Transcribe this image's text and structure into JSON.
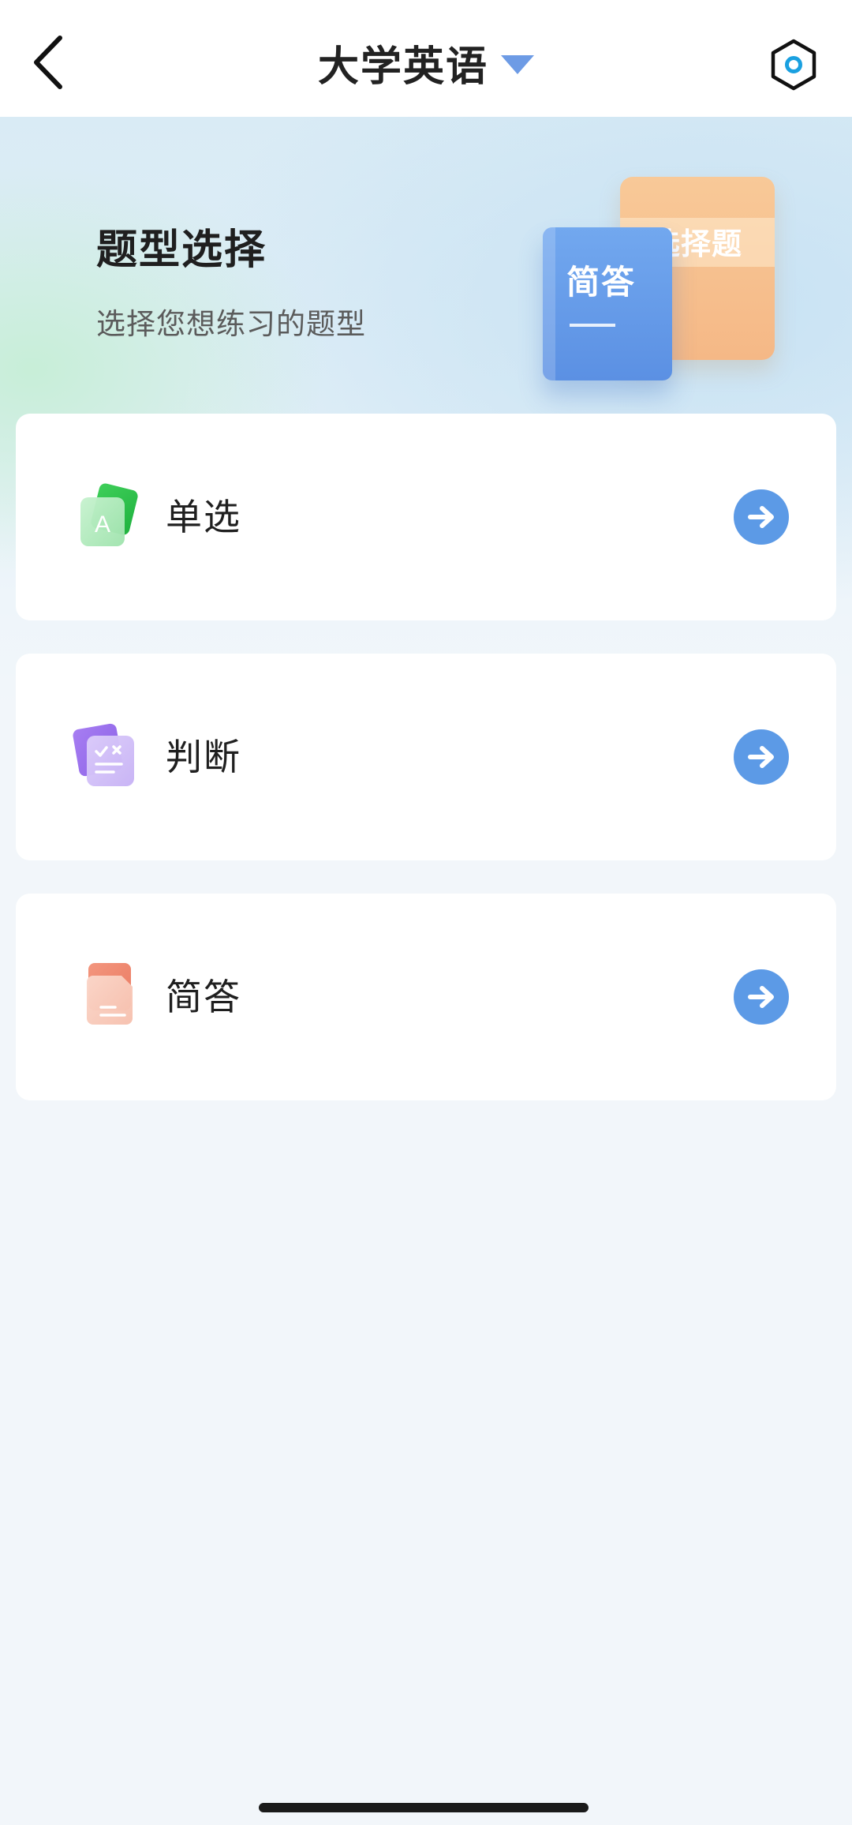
{
  "header": {
    "title": "大学英语",
    "back_icon": "chevron-left-icon",
    "dropdown_icon": "caret-down-icon",
    "settings_icon": "hexagon-settings-icon"
  },
  "banner": {
    "title": "题型选择",
    "subtitle": "选择您想练习的题型",
    "back_book_label": "选择题",
    "front_book_label": "简答"
  },
  "question_types": [
    {
      "label": "单选",
      "icon": "single-choice-icon",
      "arrow_icon": "arrow-right-circle-icon"
    },
    {
      "label": "判断",
      "icon": "true-false-icon",
      "arrow_icon": "arrow-right-circle-icon"
    },
    {
      "label": "简答",
      "icon": "short-answer-icon",
      "arrow_icon": "arrow-right-circle-icon"
    }
  ],
  "colors": {
    "accent": "#5c9ae6",
    "title_caret": "#6d9be5",
    "page_bg": "#f2f6fa"
  }
}
